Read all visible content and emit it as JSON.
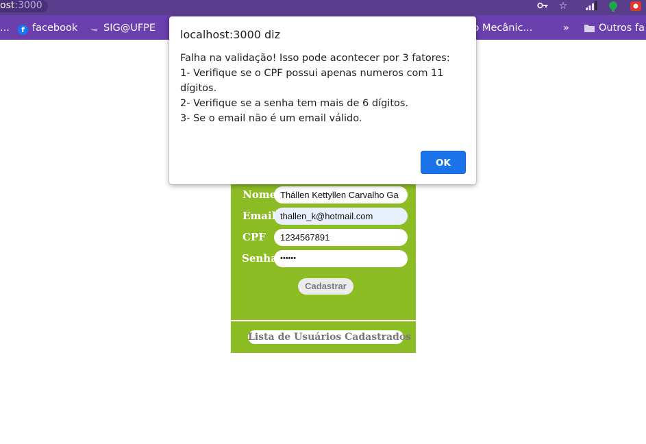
{
  "browser": {
    "url_host": "ost",
    "url_port": ":3000",
    "bookmarks": [
      {
        "label": "...",
        "icon": "ellipsis"
      },
      {
        "label": "facebook",
        "icon": "facebook-icon"
      },
      {
        "label": "SIG@UFPE",
        "icon": "sig-icon"
      },
      {
        "label": "rso Mecânic...",
        "icon": ""
      },
      {
        "label": "»",
        "icon": "chevron-right-double-icon"
      },
      {
        "label": "Outros fa",
        "icon": "folder-icon"
      }
    ]
  },
  "form": {
    "nome_label": "Nome",
    "nome_value": "Thállen Kettyllen Carvalho Ga",
    "email_label": "Email",
    "email_value": "thallen_k@hotmail.com",
    "cpf_label": "CPF",
    "cpf_value": "1234567891",
    "senha_label": "Senha",
    "senha_value": "••••••",
    "submit_label": "Cadastrar",
    "list_button_label": "Lista de Usuários Cadastrados",
    "accent_color": "#8dbd24"
  },
  "dialog": {
    "title": "localhost:3000 diz",
    "lines": [
      "Falha na validação! Isso pode acontecer por 3 fatores:",
      "1- Verifique se o CPF possui apenas numeros com 11",
      "dígitos.",
      "2- Verifique se a senha tem mais de 6 dígitos.",
      "3- Se o email não é um email válido."
    ],
    "ok_label": "OK",
    "button_color": "#1a73e8"
  }
}
